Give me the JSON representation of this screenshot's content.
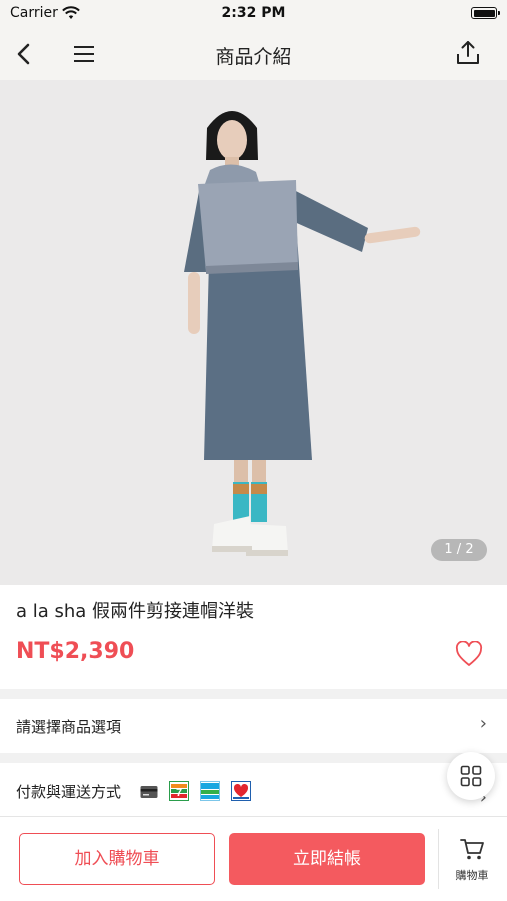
{
  "status_bar": {
    "carrier": "Carrier",
    "time": "2:32 PM"
  },
  "nav": {
    "title": "商品介紹"
  },
  "gallery": {
    "indicator": "1 / 2"
  },
  "product": {
    "name": "a la sha 假兩件剪接連帽洋裝",
    "price": "NT$2,390"
  },
  "options": {
    "label": "請選擇商品選項"
  },
  "payment": {
    "label": "付款與運送方式"
  },
  "bottom": {
    "add_to_cart": "加入購物車",
    "buy_now": "立即結帳",
    "cart_label": "購物車"
  },
  "colors": {
    "accent": "#ef4e55",
    "buy_button": "#f45a5f",
    "nav_background": "#f5f4f2"
  }
}
